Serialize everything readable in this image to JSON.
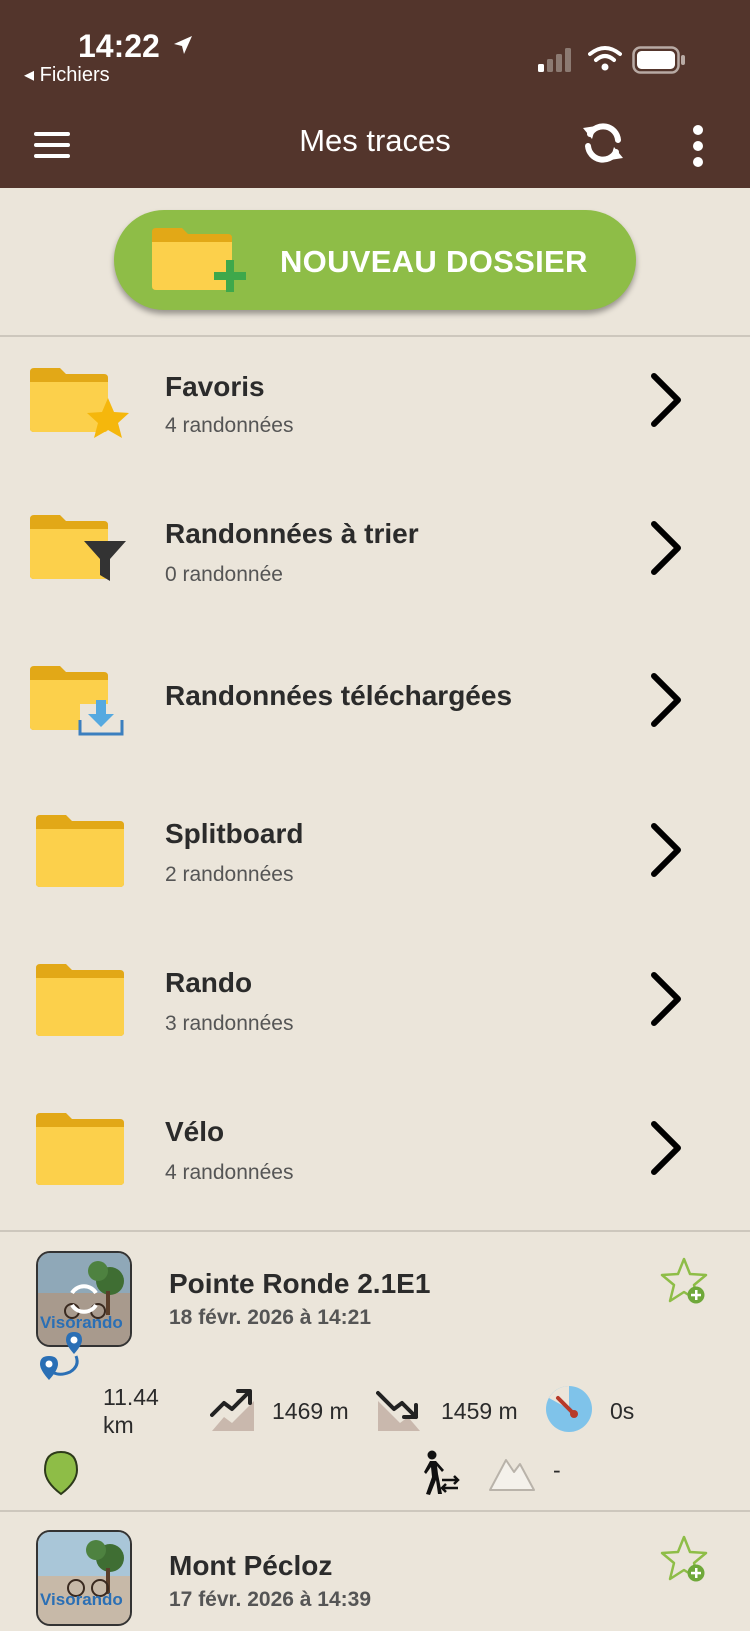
{
  "status": {
    "time": "14:22",
    "back_label": "◂ Fichiers"
  },
  "header": {
    "title": "Mes traces"
  },
  "new_folder": {
    "label": "NOUVEAU DOSSIER"
  },
  "folders": [
    {
      "name": "Favoris",
      "count": "4 randonnées"
    },
    {
      "name": "Randonnées à trier",
      "count": "0 randonnée"
    },
    {
      "name": "Randonnées téléchargées",
      "count": ""
    },
    {
      "name": "Splitboard",
      "count": "2 randonnées"
    },
    {
      "name": "Rando",
      "count": "3 randonnées"
    },
    {
      "name": "Vélo",
      "count": "4 randonnées"
    }
  ],
  "hikes": [
    {
      "title": "Pointe Ronde 2.1E1",
      "date": "18 févr. 2026 à 14:21",
      "thumb_label": "Visorando",
      "distance": "11.44",
      "distance_unit": "km",
      "ascent": "1469 m",
      "descent": "1459 m",
      "duration": "0s",
      "difficulty": "-"
    },
    {
      "title": "Mont Pécloz",
      "date": "17 févr. 2026 à 14:39",
      "thumb_label": "Visorando"
    }
  ],
  "colors": {
    "header_bg": "#53352c",
    "background": "#ebe5da",
    "accent_green": "#8ebd47",
    "folder_yellow": "#fcc93c"
  }
}
